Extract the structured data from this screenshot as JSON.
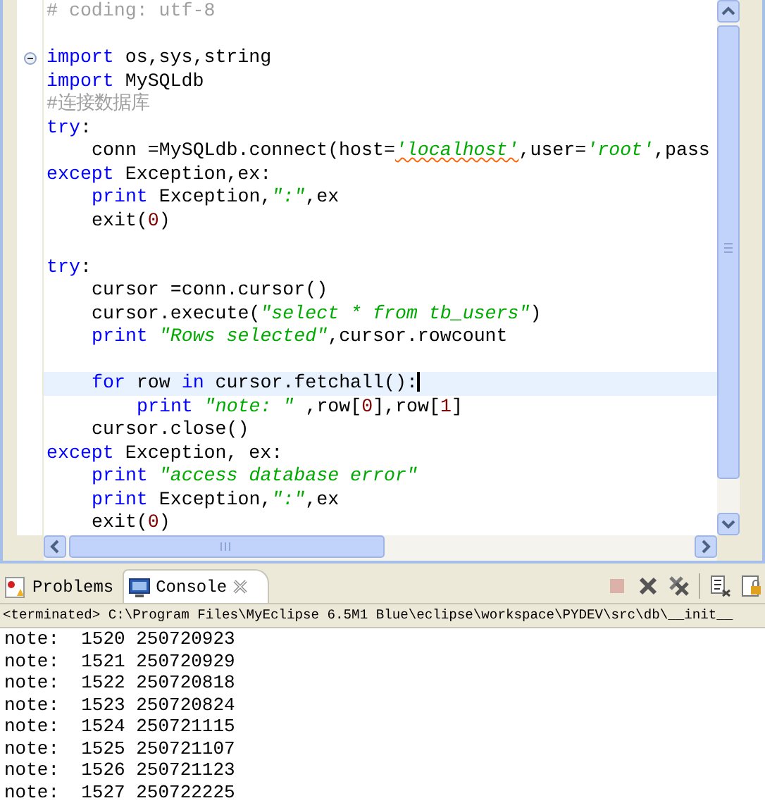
{
  "editor": {
    "lines": [
      {
        "current": false,
        "fold": false,
        "tokens": [
          {
            "text": "# coding: utf-8",
            "kind": "comment"
          }
        ]
      },
      {
        "current": false,
        "fold": false
      },
      {
        "current": false,
        "fold": true,
        "tokens": [
          {
            "text": "import",
            "kind": "keyword"
          },
          {
            "text": " os,sys,string",
            "kind": "plain"
          }
        ]
      },
      {
        "current": false,
        "fold": false,
        "tokens": [
          {
            "text": "import",
            "kind": "keyword"
          },
          {
            "text": " MySQLdb",
            "kind": "plain"
          }
        ]
      },
      {
        "current": false,
        "fold": false,
        "tokens": [
          {
            "text": "#连接数据库",
            "kind": "comment"
          }
        ]
      },
      {
        "current": false,
        "fold": false,
        "tokens": [
          {
            "text": "try",
            "kind": "keyword"
          },
          {
            "text": ":",
            "kind": "plain"
          }
        ],
        "children": [
          {
            "current": false,
            "fold": false,
            "tokens": [
              {
                "text": "conn =MySQLdb.connect(host=",
                "kind": "plain"
              },
              {
                "text": "'localhost'",
                "kind": "string",
                "warning": true
              },
              {
                "text": ",user=",
                "kind": "plain"
              },
              {
                "text": "'root'",
                "kind": "string",
                "warning": false
              },
              {
                "text": ",pass",
                "kind": "plain"
              }
            ]
          }
        ]
      },
      {
        "current": false,
        "fold": false,
        "tokens": [
          {
            "text": "except",
            "kind": "keyword"
          },
          {
            "text": " Exception,ex:",
            "kind": "plain"
          }
        ],
        "children": [
          {
            "current": false,
            "fold": false,
            "tokens": [
              {
                "text": "print",
                "kind": "keyword"
              },
              {
                "text": " Exception,",
                "kind": "plain"
              },
              {
                "text": "\":\"",
                "kind": "string"
              },
              {
                "text": ",ex",
                "kind": "plain"
              }
            ]
          },
          {
            "current": false,
            "fold": false,
            "tokens": [
              {
                "text": "exit(",
                "kind": "plain"
              },
              {
                "text": "0",
                "kind": "number"
              },
              {
                "text": ")",
                "kind": "plain"
              }
            ]
          }
        ]
      },
      {
        "current": false,
        "fold": false
      },
      {
        "current": false,
        "fold": false,
        "tokens": [
          {
            "text": "try",
            "kind": "keyword"
          },
          {
            "text": ":",
            "kind": "plain"
          }
        ],
        "children": [
          {
            "current": false,
            "fold": false,
            "tokens": [
              {
                "text": "cursor =conn.cursor()",
                "kind": "plain"
              }
            ]
          },
          {
            "current": false,
            "fold": false,
            "tokens": [
              {
                "text": "cursor.execute(",
                "kind": "plain"
              },
              {
                "text": "\"select * from tb_users\"",
                "kind": "string"
              },
              {
                "text": ")",
                "kind": "plain"
              }
            ]
          },
          {
            "current": false,
            "fold": false,
            "tokens": [
              {
                "text": "print ",
                "kind": "keyword"
              },
              {
                "text": "\"Rows selected\"",
                "kind": "string"
              },
              {
                "text": ",cursor.rowcount",
                "kind": "plain"
              }
            ]
          },
          {
            "current": false,
            "fold": false
          },
          {
            "current": true,
            "fold": false,
            "tokens": [
              {
                "text": "for",
                "kind": "keyword"
              },
              {
                "text": " row ",
                "kind": "plain"
              },
              {
                "text": "in",
                "kind": "keyword"
              },
              {
                "text": " cursor.fetchall():",
                "kind": "plain"
              }
            ],
            "children": [
              {
                "current": false,
                "fold": false,
                "tokens": [
                  {
                    "text": "print ",
                    "kind": "keyword"
                  },
                  {
                    "text": "\"note: \"",
                    "kind": "string"
                  },
                  {
                    "text": " ,row[",
                    "kind": "plain"
                  },
                  {
                    "text": "0",
                    "kind": "number"
                  },
                  {
                    "text": "],row[",
                    "kind": "plain"
                  },
                  {
                    "text": "1",
                    "kind": "number"
                  },
                  {
                    "text": "]",
                    "kind": "plain"
                  }
                ]
              }
            ]
          },
          {
            "current": false,
            "fold": false,
            "tokens": [
              {
                "text": "cursor.close()",
                "kind": "plain"
              }
            ]
          }
        ]
      },
      {
        "current": false,
        "fold": false,
        "tokens": [
          {
            "text": "except",
            "kind": "keyword"
          },
          {
            "text": " Exception, ex:",
            "kind": "plain"
          }
        ],
        "children": [
          {
            "current": false,
            "fold": false,
            "tokens": [
              {
                "text": "print ",
                "kind": "keyword"
              },
              {
                "text": "\"access database error\"",
                "kind": "string"
              }
            ]
          },
          {
            "current": false,
            "fold": false,
            "tokens": [
              {
                "text": "print",
                "kind": "keyword"
              },
              {
                "text": " Exception,",
                "kind": "plain"
              },
              {
                "text": "\":\"",
                "kind": "string"
              },
              {
                "text": ",ex",
                "kind": "plain"
              }
            ]
          },
          {
            "current": false,
            "fold": false,
            "tokens": [
              {
                "text": "exit(",
                "kind": "plain"
              },
              {
                "text": "0",
                "kind": "number"
              },
              {
                "text": ")",
                "kind": "plain"
              }
            ]
          }
        ]
      }
    ]
  },
  "panel": {
    "tabs": [
      {
        "label": "Problems",
        "kind": "problems",
        "selected": false,
        "closable": false
      },
      {
        "label": "Console",
        "kind": "console",
        "selected": true,
        "closable": true
      }
    ],
    "toolbar": [
      {
        "kind": "terminate",
        "disabled": true
      },
      {
        "kind": "remove",
        "disabled": false
      },
      {
        "kind": "remove-all",
        "disabled": false
      },
      {
        "kind": "clear",
        "disabled": false
      },
      {
        "kind": "lock",
        "disabled": false
      }
    ],
    "console_title": "<terminated> C:\\Program Files\\MyEclipse 6.5M1 Blue\\eclipse\\workspace\\PYDEV\\src\\db\\__init__",
    "output": [
      "note:  1520 250720923",
      "note:  1521 250720929",
      "note:  1522 250720818",
      "note:  1523 250720824",
      "note:  1524 250721115",
      "note:  1525 250721107",
      "note:  1526 250721123",
      "note:  1527 250722225"
    ]
  }
}
